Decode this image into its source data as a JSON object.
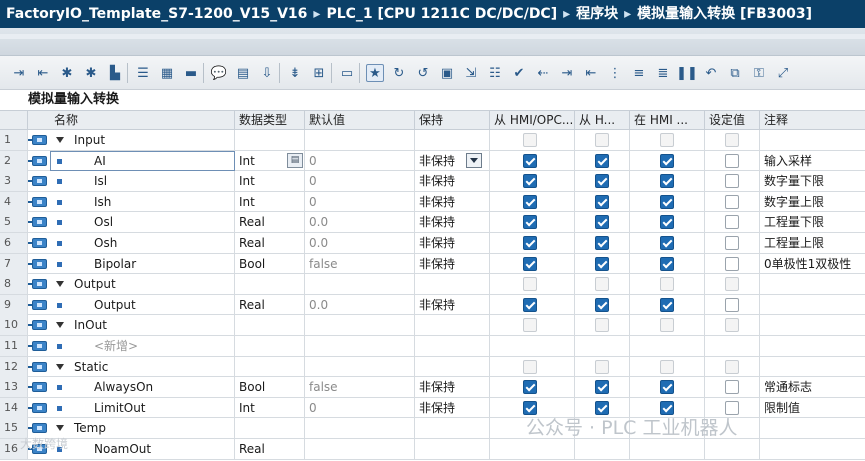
{
  "title": {
    "parts": [
      "FactoryIO_Template_S7-1200_V15_V16",
      "PLC_1 [CPU 1211C DC/DC/DC]",
      "程序块",
      "模拟量输入转换 [FB3003]"
    ],
    "separator": "▸"
  },
  "block_name": "模拟量输入转换",
  "headers": {
    "name": "名称",
    "type": "数据类型",
    "default": "默认值",
    "retain": "保持",
    "hmi_access": "从 HMI/OPC...",
    "hmi_write": "从 H...",
    "hmi_visible": "在 HMI ...",
    "setpoint": "设定值",
    "comment": "注释"
  },
  "rows": [
    {
      "n": "1",
      "name": "Input",
      "kind": "section",
      "type": "",
      "def": "",
      "ret": "",
      "c": [
        false,
        false,
        false,
        false
      ],
      "cm": ""
    },
    {
      "n": "2",
      "name": "AI",
      "kind": "var",
      "type": "Int",
      "def": "0",
      "ret": "非保持",
      "c": [
        true,
        true,
        true,
        false
      ],
      "cm": "输入采样",
      "selected": true
    },
    {
      "n": "3",
      "name": "Isl",
      "kind": "var",
      "type": "Int",
      "def": "0",
      "ret": "非保持",
      "c": [
        true,
        true,
        true,
        false
      ],
      "cm": "数字量下限"
    },
    {
      "n": "4",
      "name": "Ish",
      "kind": "var",
      "type": "Int",
      "def": "0",
      "ret": "非保持",
      "c": [
        true,
        true,
        true,
        false
      ],
      "cm": "数字量上限"
    },
    {
      "n": "5",
      "name": "Osl",
      "kind": "var",
      "type": "Real",
      "def": "0.0",
      "ret": "非保持",
      "c": [
        true,
        true,
        true,
        false
      ],
      "cm": "工程量下限"
    },
    {
      "n": "6",
      "name": "Osh",
      "kind": "var",
      "type": "Real",
      "def": "0.0",
      "ret": "非保持",
      "c": [
        true,
        true,
        true,
        false
      ],
      "cm": "工程量上限"
    },
    {
      "n": "7",
      "name": "Bipolar",
      "kind": "var",
      "type": "Bool",
      "def": "false",
      "ret": "非保持",
      "c": [
        true,
        true,
        true,
        false
      ],
      "cm": "0单极性1双极性"
    },
    {
      "n": "8",
      "name": "Output",
      "kind": "section",
      "type": "",
      "def": "",
      "ret": "",
      "c": [
        false,
        false,
        false,
        false
      ],
      "cm": ""
    },
    {
      "n": "9",
      "name": "Output",
      "kind": "var",
      "type": "Real",
      "def": "0.0",
      "ret": "非保持",
      "c": [
        true,
        true,
        true,
        false
      ],
      "cm": ""
    },
    {
      "n": "10",
      "name": "InOut",
      "kind": "section",
      "type": "",
      "def": "",
      "ret": "",
      "c": [
        false,
        false,
        false,
        false
      ],
      "cm": ""
    },
    {
      "n": "11",
      "name": "<新增>",
      "kind": "add",
      "type": "",
      "def": "",
      "ret": "",
      "c": [
        null,
        null,
        null,
        null
      ],
      "cm": ""
    },
    {
      "n": "12",
      "name": "Static",
      "kind": "section",
      "type": "",
      "def": "",
      "ret": "",
      "c": [
        false,
        false,
        false,
        false
      ],
      "cm": ""
    },
    {
      "n": "13",
      "name": "AlwaysOn",
      "kind": "var",
      "type": "Bool",
      "def": "false",
      "ret": "非保持",
      "c": [
        true,
        true,
        true,
        false
      ],
      "cm": "常通标志"
    },
    {
      "n": "14",
      "name": "LimitOut",
      "kind": "var",
      "type": "Int",
      "def": "0",
      "ret": "非保持",
      "c": [
        true,
        true,
        true,
        false
      ],
      "cm": "限制值"
    },
    {
      "n": "15",
      "name": "Temp",
      "kind": "section",
      "type": "",
      "def": "",
      "ret": "",
      "c": [
        null,
        null,
        null,
        null
      ],
      "cm": ""
    },
    {
      "n": "16",
      "name": "NoamOut",
      "kind": "var",
      "type": "Real",
      "def": "",
      "ret": "",
      "c": [
        null,
        null,
        null,
        null
      ],
      "cm": ""
    }
  ],
  "watermark": "公众号 · PLC 工业机器人",
  "watermark2": "大数跨境",
  "toolbar": {
    "icons": [
      "insert-row-icon",
      "delete-row-icon",
      "add-icon",
      "add-icon-2",
      "ob-icon",
      "list-view-icon",
      "grid-view-icon",
      "bar-view-icon",
      "comment-bubble-icon",
      "monitor-icon",
      "download-icon",
      "import-icon",
      "snapshot-icon",
      "select-icon",
      "favorite-icon",
      "cycle-icon",
      "refresh-icon",
      "save-icon",
      "export-icon",
      "list-icon",
      "check-icon",
      "go-left-icon",
      "indent-icon",
      "outdent-icon",
      "tree-icon",
      "text-icon",
      "align-icon",
      "pause-icon",
      "reload-icon",
      "copy-icon",
      "lock-icon",
      "expand-icon"
    ]
  }
}
